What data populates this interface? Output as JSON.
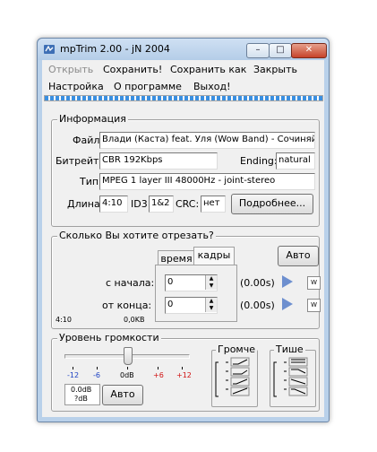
{
  "window": {
    "title": "mpTrim 2.00 - jN 2004",
    "min_glyph": "–",
    "max_glyph": "□",
    "close_glyph": "✕"
  },
  "menu": {
    "row1": [
      "Открыть",
      "Сохранить!",
      "Сохранить как",
      "Закрыть"
    ],
    "row2": [
      "Настройка",
      "О программе",
      "Выход!"
    ]
  },
  "info": {
    "legend": "Информация",
    "file_label": "Файл:",
    "file_value": "Влади (Каста) feat. Уля (Wow Band) - Сочиняй М",
    "bitrate_label": "Битрейт:",
    "bitrate_value": "CBR 192Kbps",
    "ending_label": "Ending:",
    "ending_value": "natural",
    "type_label": "Тип:",
    "type_value": "MPEG 1 layer III 48000Hz - joint-stereo",
    "length_label": "Длина:",
    "length_value": "4:10",
    "id3_label": "ID3:",
    "id3_value": "1&2",
    "crc_label": "CRC:",
    "crc_value": "нет",
    "details_button": "Подробнее..."
  },
  "cut": {
    "legend": "Сколько Вы хотите отрезать?",
    "tab_time": "время",
    "tab_frames": "кадры",
    "auto_button": "Авто",
    "start_label": "с начала:",
    "start_value": "0",
    "start_time": "(0.00s)",
    "end_label": "от конца:",
    "end_value": "0",
    "end_time": "(0.00s)",
    "w_label": "w",
    "total_length": "4:10",
    "total_size": "0,0KB"
  },
  "volume": {
    "legend": "Уровень громкости",
    "ticks": [
      "-12",
      "-6",
      "0dB",
      "+6",
      "+12"
    ],
    "slider_level_db": 0,
    "readout_db": "0.0dB",
    "readout_db2": "?dB",
    "auto_button": "Авто",
    "louder_legend": "Громче",
    "quieter_legend": "Тише"
  },
  "colors": {
    "tick_negative": "#1a3fc2",
    "tick_positive": "#d01010",
    "accent_play": "#6d8fcf"
  }
}
